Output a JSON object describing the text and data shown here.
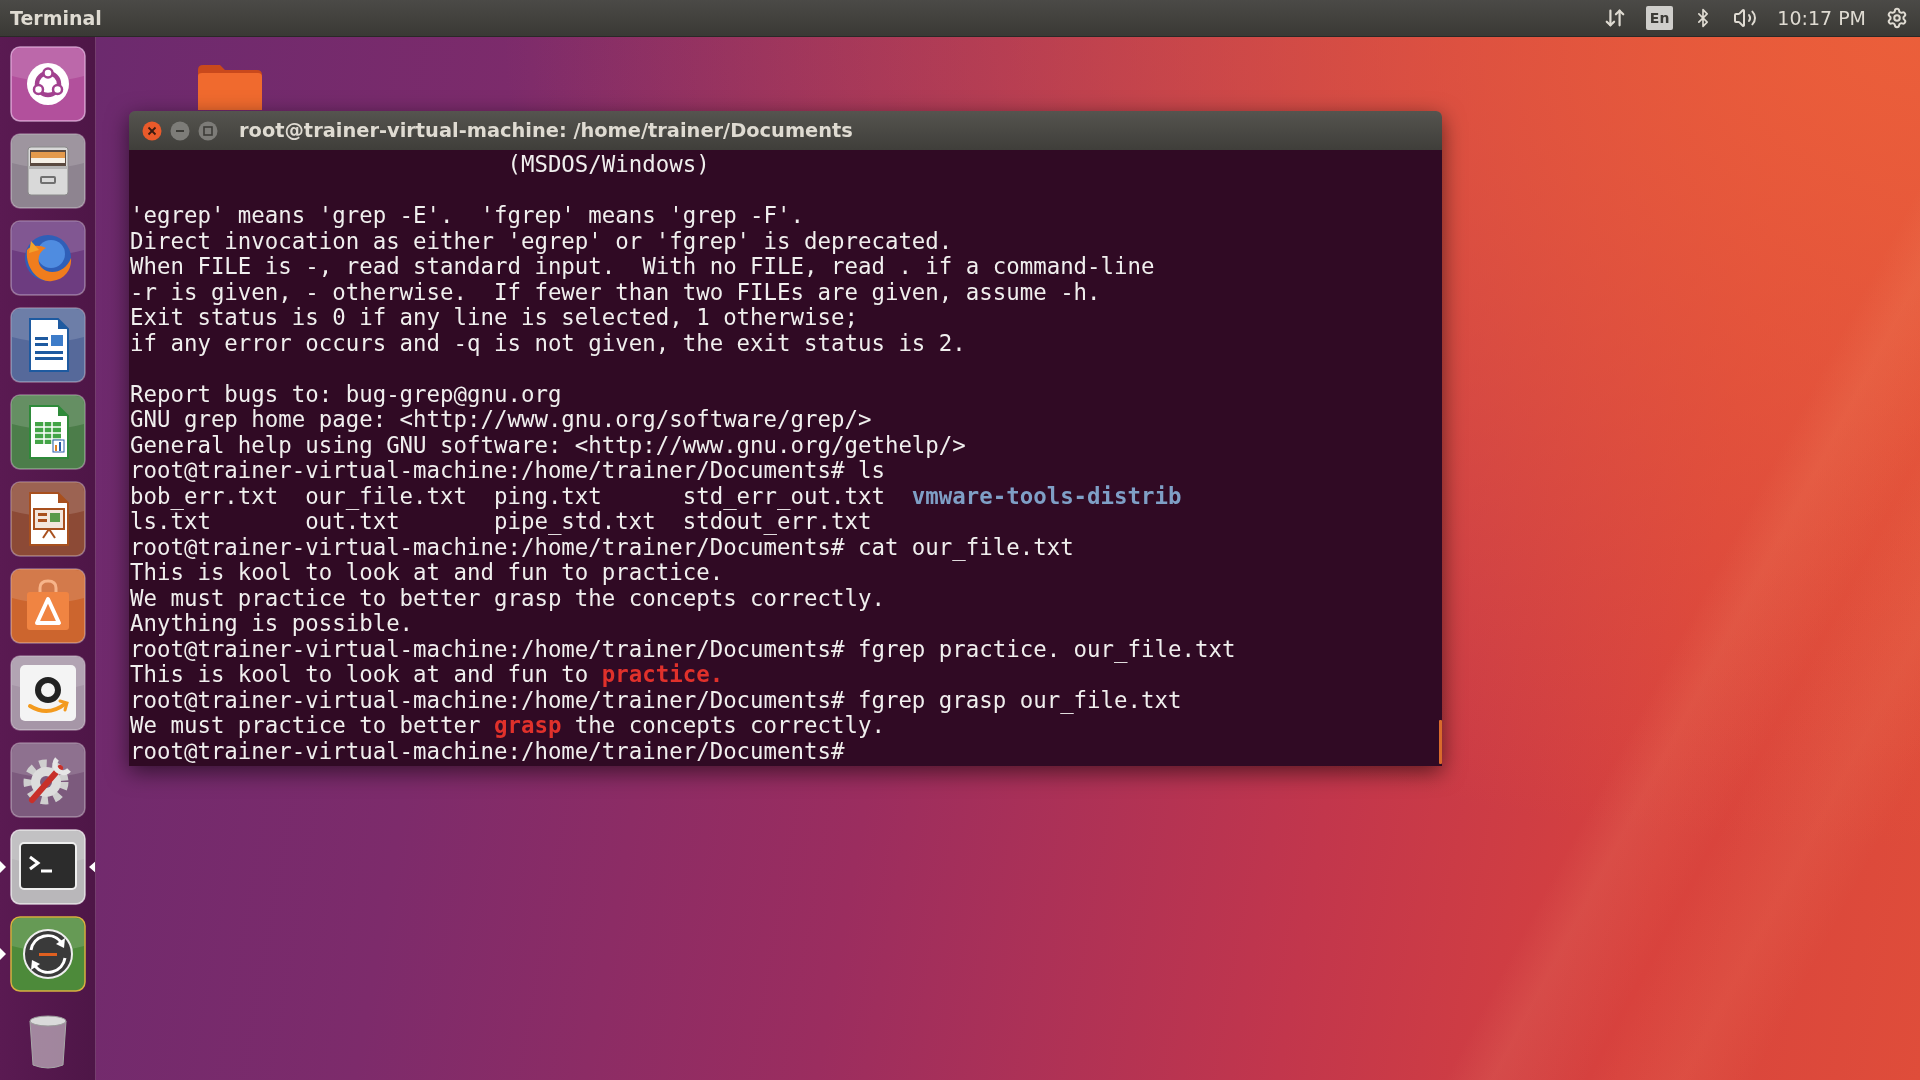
{
  "top_panel": {
    "app_title": "Terminal",
    "keyboard_layout": "En",
    "clock": "10:17 PM"
  },
  "launcher": {
    "items": [
      {
        "kind": "dash",
        "running": false,
        "focused": false
      },
      {
        "kind": "files",
        "running": false,
        "focused": false
      },
      {
        "kind": "browser",
        "running": false,
        "focused": false
      },
      {
        "kind": "writer",
        "running": false,
        "focused": false
      },
      {
        "kind": "calc",
        "running": false,
        "focused": false
      },
      {
        "kind": "impress",
        "running": false,
        "focused": false
      },
      {
        "kind": "store",
        "running": false,
        "focused": false
      },
      {
        "kind": "amazon",
        "running": false,
        "focused": false
      },
      {
        "kind": "settings",
        "running": false,
        "focused": false
      },
      {
        "kind": "terminal",
        "running": true,
        "focused": true
      },
      {
        "kind": "updater",
        "running": true,
        "focused": false
      },
      {
        "kind": "trash",
        "running": false,
        "focused": false
      }
    ]
  },
  "terminal_window": {
    "title": "root@trainer-virtual-machine: /home/trainer/Documents",
    "lines": [
      {
        "kind": "text",
        "segments": [
          {
            "kind": "plain",
            "text": "                            (MSDOS/Windows)"
          }
        ]
      },
      {
        "kind": "blank"
      },
      {
        "kind": "text",
        "segments": [
          {
            "kind": "plain",
            "text": "'egrep' means 'grep -E'.  'fgrep' means 'grep -F'."
          }
        ]
      },
      {
        "kind": "text",
        "segments": [
          {
            "kind": "plain",
            "text": "Direct invocation as either 'egrep' or 'fgrep' is deprecated."
          }
        ]
      },
      {
        "kind": "text",
        "segments": [
          {
            "kind": "plain",
            "text": "When FILE is -, read standard input.  With no FILE, read . if a command-line"
          }
        ]
      },
      {
        "kind": "text",
        "segments": [
          {
            "kind": "plain",
            "text": "-r is given, - otherwise.  If fewer than two FILEs are given, assume -h."
          }
        ]
      },
      {
        "kind": "text",
        "segments": [
          {
            "kind": "plain",
            "text": "Exit status is 0 if any line is selected, 1 otherwise;"
          }
        ]
      },
      {
        "kind": "text",
        "segments": [
          {
            "kind": "plain",
            "text": "if any error occurs and -q is not given, the exit status is 2."
          }
        ]
      },
      {
        "kind": "blank"
      },
      {
        "kind": "text",
        "segments": [
          {
            "kind": "plain",
            "text": "Report bugs to: bug-grep@gnu.org"
          }
        ]
      },
      {
        "kind": "text",
        "segments": [
          {
            "kind": "plain",
            "text": "GNU grep home page: <http://www.gnu.org/software/grep/>"
          }
        ]
      },
      {
        "kind": "text",
        "segments": [
          {
            "kind": "plain",
            "text": "General help using GNU software: <http://www.gnu.org/gethelp/>"
          }
        ]
      },
      {
        "kind": "text",
        "segments": [
          {
            "kind": "plain",
            "text": "root@trainer-virtual-machine:/home/trainer/Documents# ls"
          }
        ]
      },
      {
        "kind": "text",
        "segments": [
          {
            "kind": "plain",
            "text": "bob_err.txt  our_file.txt  ping.txt      std_err_out.txt  "
          },
          {
            "kind": "directory",
            "text": "vmware-tools-distrib"
          }
        ]
      },
      {
        "kind": "text",
        "segments": [
          {
            "kind": "plain",
            "text": "ls.txt       out.txt       pipe_std.txt  stdout_err.txt"
          }
        ]
      },
      {
        "kind": "text",
        "segments": [
          {
            "kind": "plain",
            "text": "root@trainer-virtual-machine:/home/trainer/Documents# cat our_file.txt"
          }
        ]
      },
      {
        "kind": "text",
        "segments": [
          {
            "kind": "plain",
            "text": "This is kool to look at and fun to practice."
          }
        ]
      },
      {
        "kind": "text",
        "segments": [
          {
            "kind": "plain",
            "text": "We must practice to better grasp the concepts correctly."
          }
        ]
      },
      {
        "kind": "text",
        "segments": [
          {
            "kind": "plain",
            "text": "Anything is possible."
          }
        ]
      },
      {
        "kind": "text",
        "segments": [
          {
            "kind": "plain",
            "text": "root@trainer-virtual-machine:/home/trainer/Documents# fgrep practice. our_file.txt"
          }
        ]
      },
      {
        "kind": "text",
        "segments": [
          {
            "kind": "plain",
            "text": "This is kool to look at and fun to "
          },
          {
            "kind": "match",
            "text": "practice."
          }
        ]
      },
      {
        "kind": "text",
        "segments": [
          {
            "kind": "plain",
            "text": "root@trainer-virtual-machine:/home/trainer/Documents# fgrep grasp our_file.txt"
          }
        ]
      },
      {
        "kind": "text",
        "segments": [
          {
            "kind": "plain",
            "text": "We must practice to better "
          },
          {
            "kind": "match",
            "text": "grasp"
          },
          {
            "kind": "plain",
            "text": " the concepts correctly."
          }
        ]
      },
      {
        "kind": "text",
        "segments": [
          {
            "kind": "plain",
            "text": "root@trainer-virtual-machine:/home/trainer/Documents#"
          }
        ]
      }
    ]
  }
}
